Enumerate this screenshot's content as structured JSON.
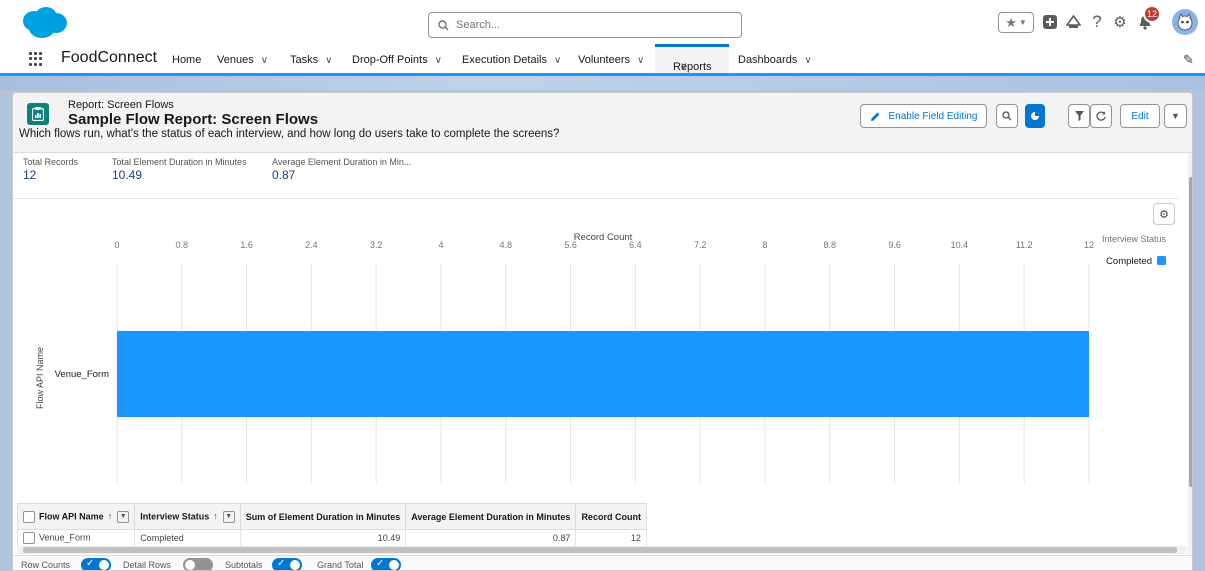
{
  "header": {
    "search_placeholder": "Search...",
    "notification_count": "12"
  },
  "nav": {
    "app_name": "FoodConnect",
    "items": [
      {
        "label": "Home",
        "has_menu": false
      },
      {
        "label": "Venues",
        "has_menu": true
      },
      {
        "label": "Tasks",
        "has_menu": true
      },
      {
        "label": "Drop-Off Points",
        "has_menu": true
      },
      {
        "label": "Execution Details",
        "has_menu": true
      },
      {
        "label": "Volunteers",
        "has_menu": true
      },
      {
        "label": "Reports",
        "has_menu": true,
        "active": true
      },
      {
        "label": "Dashboards",
        "has_menu": true
      }
    ]
  },
  "report": {
    "type_label": "Report: Screen Flows",
    "title": "Sample Flow Report: Screen Flows",
    "description": "Which flows run, what's the status of each interview, and how long do users take to complete the screens?",
    "enable_field_editing_label": "Enable Field Editing",
    "edit_label": "Edit",
    "summary": [
      {
        "label": "Total Records",
        "value": "12"
      },
      {
        "label": "Total Element Duration in Minutes",
        "value": "10.49"
      },
      {
        "label": "Average Element Duration in Min...",
        "value": "0.87"
      }
    ]
  },
  "chart_data": {
    "type": "bar",
    "orientation": "horizontal",
    "title": "",
    "xlabel": "Record Count",
    "ylabel": "Flow API Name",
    "categories": [
      "Venue_Form"
    ],
    "series": [
      {
        "name": "Completed",
        "values": [
          12
        ],
        "color": "#1b96ff"
      }
    ],
    "xlim": [
      0,
      12
    ],
    "xticks": [
      "0",
      "0.8",
      "1.6",
      "2.4",
      "3.2",
      "4",
      "4.8",
      "5.6",
      "6.4",
      "7.2",
      "8",
      "8.8",
      "9.6",
      "10.4",
      "11.2",
      "12"
    ],
    "legend_title": "Interview Status",
    "legend_position": "top-right",
    "grid": true
  },
  "table": {
    "columns": [
      "Flow API Name",
      "Interview Status",
      "Sum of Element Duration in Minutes",
      "Average Element Duration in Minutes",
      "Record Count"
    ],
    "rows": [
      [
        "Venue_Form",
        "Completed",
        "10.49",
        "0.87",
        "12"
      ]
    ]
  },
  "footer": {
    "toggles": [
      {
        "label": "Row Counts",
        "on": true
      },
      {
        "label": "Detail Rows",
        "on": false
      },
      {
        "label": "Subtotals",
        "on": true
      },
      {
        "label": "Grand Total",
        "on": true
      }
    ]
  },
  "colors": {
    "accent": "#0176d3",
    "bar": "#1b96ff",
    "report_icon": "#0b827c",
    "badge": "#c23934"
  }
}
